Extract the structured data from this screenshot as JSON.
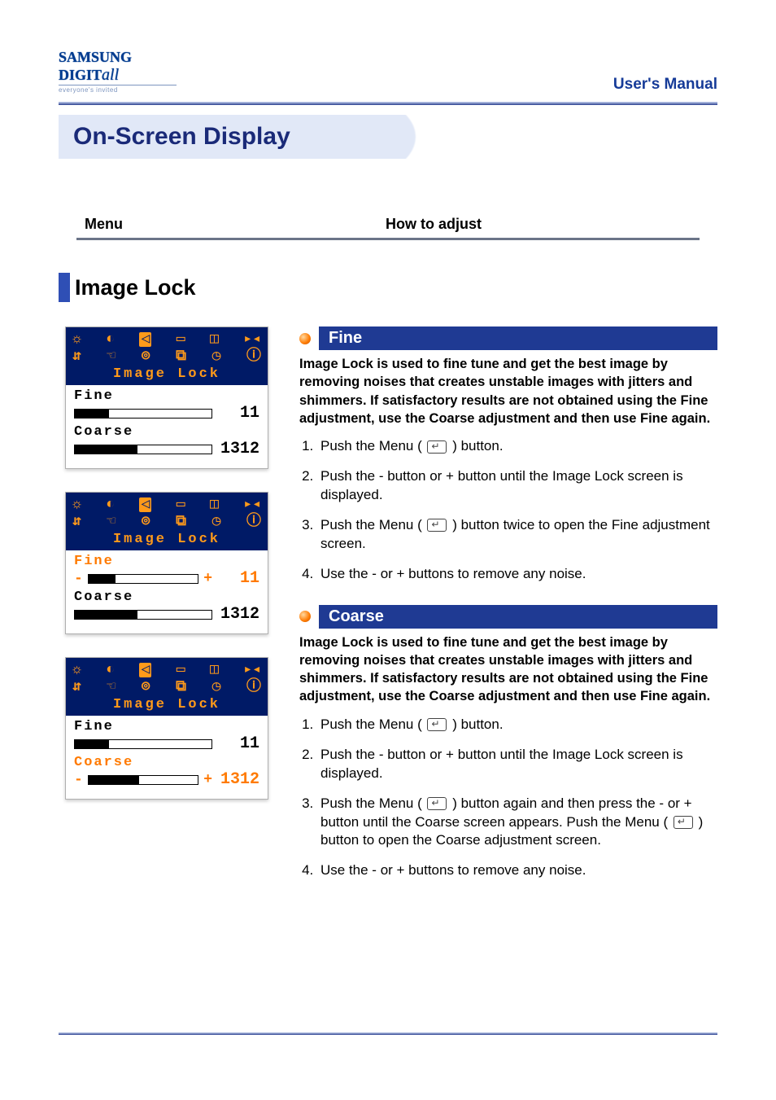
{
  "header": {
    "logo_main_a": "SAMSUNG DIGIT",
    "logo_main_b": "all",
    "logo_sub": "everyone's invited",
    "manual": "User's Manual"
  },
  "page_title": "On-Screen Display",
  "headings": {
    "menu": "Menu",
    "adjust": "How to adjust"
  },
  "section": "Image Lock",
  "osd": {
    "category": "Image Lock",
    "fine_label": "Fine",
    "coarse_label": "Coarse",
    "panels": [
      {
        "highlight": "none",
        "fine": 11,
        "fine_pct": 25,
        "coarse": 1312,
        "coarse_pct": 46,
        "fine_signs": false,
        "coarse_signs": false
      },
      {
        "highlight": "fine",
        "fine": 11,
        "fine_pct": 25,
        "coarse": 1312,
        "coarse_pct": 46,
        "fine_signs": true,
        "coarse_signs": false
      },
      {
        "highlight": "coarse",
        "fine": 11,
        "fine_pct": 25,
        "coarse": 1312,
        "coarse_pct": 46,
        "fine_signs": false,
        "coarse_signs": true
      }
    ]
  },
  "fine": {
    "heading": "Fine",
    "desc": "Image Lock is used to fine tune and get the best image by removing noises that creates unstable images with jitters and shimmers. If satisfactory results are not obtained using the Fine adjustment, use the Coarse adjustment and then use Fine again.",
    "steps": [
      "Push the Menu ( [M] ) button.",
      "Push the - button or + button until the Image Lock screen is displayed.",
      "Push the Menu ( [M] ) button twice to open the Fine adjustment screen.",
      "Use the - or + buttons to remove any noise."
    ]
  },
  "coarse": {
    "heading": "Coarse",
    "desc": "Image Lock is used to fine tune and get the best image by removing noises that creates unstable images with jitters and shimmers. If satisfactory results are not obtained using the Fine adjustment, use the Coarse adjustment and then use Fine again.",
    "steps": [
      "Push the Menu ( [M] ) button.",
      "Push the - button or + button until the Image Lock screen is displayed.",
      "Push the Menu ( [M] ) button again and then  press the - or + button until the Coarse screen appears. Push the Menu ( [M] ) button to open the Coarse adjustment screen.",
      "Use the - or + buttons to remove any noise."
    ]
  }
}
